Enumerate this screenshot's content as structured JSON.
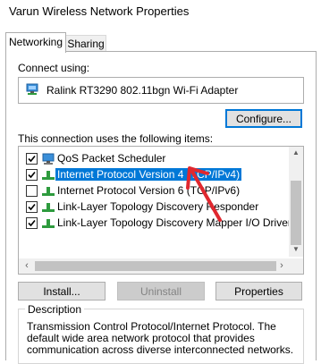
{
  "window": {
    "title": "Varun Wireless Network Properties"
  },
  "tabs": [
    {
      "label": "Networking"
    },
    {
      "label": "Sharing"
    }
  ],
  "connect_using": {
    "label": "Connect using:",
    "adapter": "Ralink RT3290 802.11bgn Wi-Fi Adapter",
    "configure_label": "Configure..."
  },
  "items_section": {
    "label": "This connection uses the following items:",
    "items": [
      {
        "label": "QoS Packet Scheduler",
        "checked": true,
        "selected": false
      },
      {
        "label": "Internet Protocol Version 4 (TCP/IPv4)",
        "checked": true,
        "selected": true
      },
      {
        "label": "Internet Protocol Version 6 (TCP/IPv6)",
        "checked": false,
        "selected": false
      },
      {
        "label": "Link-Layer Topology Discovery Responder",
        "checked": true,
        "selected": false
      },
      {
        "label": "Link-Layer Topology Discovery Mapper I/O Driver",
        "checked": true,
        "selected": false
      }
    ]
  },
  "buttons": {
    "install": "Install...",
    "uninstall": "Uninstall",
    "properties": "Properties"
  },
  "description": {
    "title": "Description",
    "text": "Transmission Control Protocol/Internet Protocol. The default wide area network protocol that provides communication across diverse interconnected networks."
  },
  "colors": {
    "selection": "#0078d7",
    "annotation_arrow": "#e0282f",
    "focus_border": "#0078d7"
  }
}
